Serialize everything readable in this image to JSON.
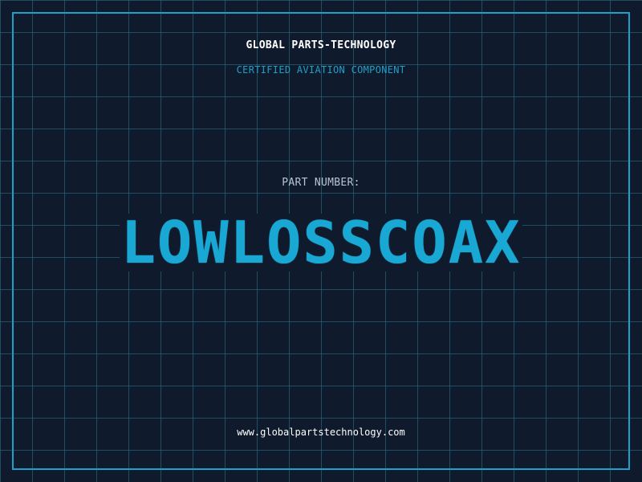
{
  "header": {
    "company": "GLOBAL PARTS-TECHNOLOGY",
    "subtitle": "CERTIFIED AVIATION COMPONENT"
  },
  "main": {
    "part_label": "PART NUMBER:",
    "part_number": "LOWLOSSCOAX"
  },
  "footer": {
    "url": "www.globalpartstechnology.com"
  },
  "colors": {
    "background": "#101a2d",
    "grid": "#2e788c",
    "accent": "#1fa0c8",
    "text_primary": "#ffffff",
    "text_muted": "#b8c4d3"
  }
}
